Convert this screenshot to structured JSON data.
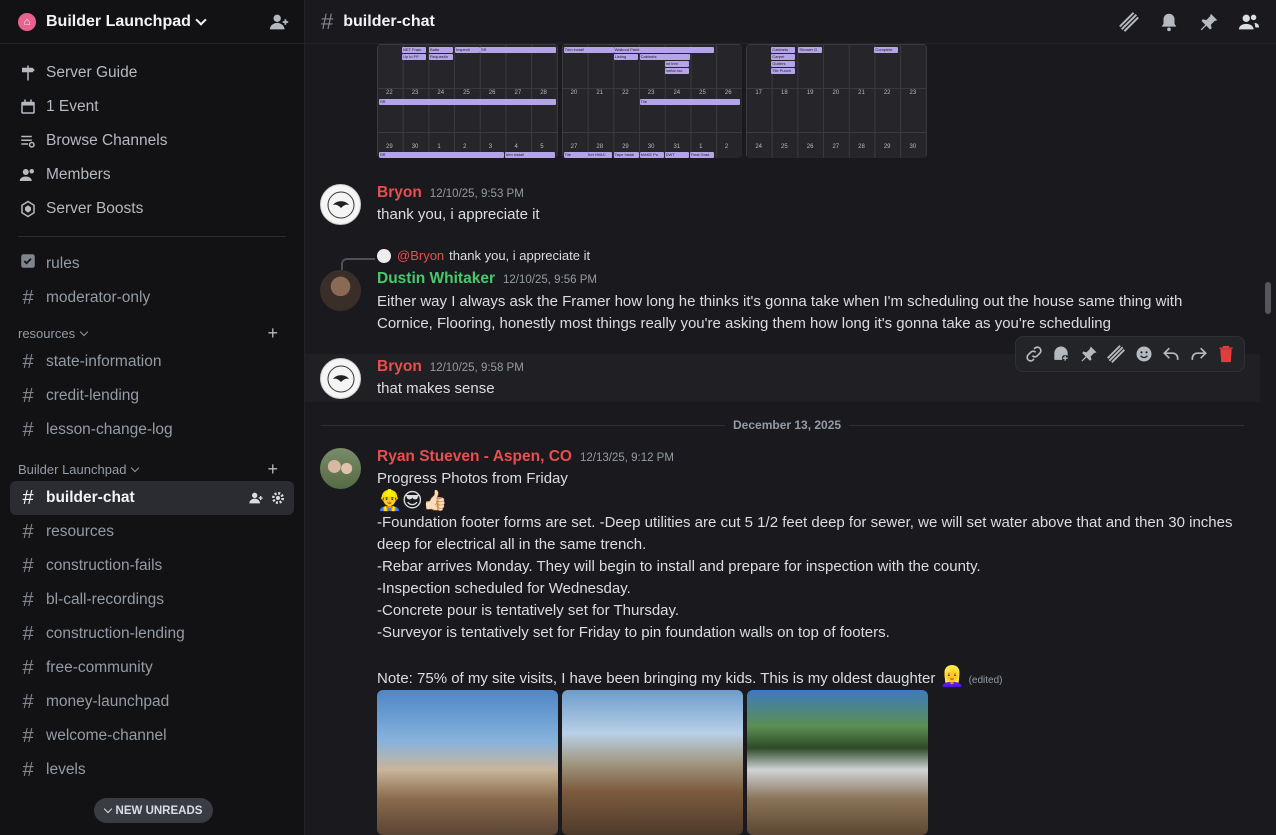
{
  "server": {
    "name": "Builder Launchpad"
  },
  "nav": [
    {
      "label": "Server Guide",
      "icon": "signpost-icon"
    },
    {
      "label": "1 Event",
      "icon": "calendar-icon"
    },
    {
      "label": "Browse Channels",
      "icon": "browse-icon"
    },
    {
      "label": "Members",
      "icon": "members-icon"
    },
    {
      "label": "Server Boosts",
      "icon": "boost-icon"
    }
  ],
  "top_channels": [
    {
      "label": "rules",
      "icon": "checklist-icon"
    },
    {
      "label": "moderator-only",
      "icon": "hash-lock-icon"
    }
  ],
  "categories": {
    "resources": {
      "label": "resources",
      "channels": [
        "state-information",
        "credit-lending",
        "lesson-change-log"
      ]
    },
    "launchpad": {
      "label": "Builder Launchpad",
      "channels": [
        "builder-chat",
        "resources",
        "construction-fails",
        "bl-call-recordings",
        "construction-lending",
        "free-community",
        "money-launchpad",
        "welcome-channel",
        "levels"
      ]
    }
  },
  "new_unreads": "NEW UNREADS",
  "channel": {
    "title": "builder-chat"
  },
  "messages": {
    "m1": {
      "author": "Bryon",
      "timestamp": "12/10/25, 9:53 PM",
      "text": "thank you, i appreciate it"
    },
    "m2": {
      "reply_mention": "@Bryon",
      "reply_text": "thank you, i appreciate it",
      "author": "Dustin Whitaker",
      "timestamp": "12/10/25, 9:56 PM",
      "text": "Either way I always ask the Framer how long he thinks it's gonna take when I'm scheduling out the house same thing with Cornice, Flooring, honestly most things really you're asking them how long it's gonna take as you're scheduling"
    },
    "m3": {
      "author": "Bryon",
      "timestamp": "12/10/25, 9:58 PM",
      "text": "that makes sense"
    },
    "date_divider": "December 13, 2025",
    "m4": {
      "author": "Ryan Stueven - Aspen, CO",
      "timestamp": "12/13/25, 9:12 PM",
      "line1": "Progress Photos from Friday",
      "emojis": "👷‍♂️😎👍🏻",
      "line2": "-Foundation footer forms are set. -Deep utilities are cut 5 1/2 feet deep for sewer, we will set water above that and then 30 inches deep for electrical all in the same trench.",
      "line3": "-Rebar arrives Monday. They will begin to install and prepare for inspection with the county.",
      "line4": "-Inspection scheduled for Wednesday.",
      "line5": "-Concrete pour is tentatively set for Thursday.",
      "line6": "-Surveyor is tentatively set for Friday to pin foundation walls on top of footers.",
      "note": "Note: 75% of my site visits, I have been bringing my kids. This is my oldest daughter",
      "note_emoji": "👱‍♀️",
      "edited": "(edited)"
    }
  },
  "calendar": {
    "labels": [
      "NET Fram",
      "Batte",
      "Inspecti",
      "SR",
      "Trim install",
      "Walkout Paint",
      "Cabinets",
      "Shower G",
      "Complete",
      "Up to FP",
      "Requestin",
      "Listing",
      "Cabinets",
      "Carpet",
      "Gutters",
      "Tile Punch",
      "Int trim",
      "metal roo",
      "SR",
      "Tile",
      "SR",
      "trim install",
      "Tile",
      "Set HVAC",
      "Tape Instal",
      "MAKE Pu",
      "DWT",
      "Final Grad"
    ],
    "days": [
      "22",
      "23",
      "24",
      "25",
      "26",
      "27",
      "28",
      "20",
      "21",
      "22",
      "23",
      "24",
      "25",
      "26",
      "17",
      "18",
      "19",
      "20",
      "21",
      "22",
      "23",
      "29",
      "30",
      "1",
      "2",
      "3",
      "4",
      "5",
      "27",
      "28",
      "29",
      "30",
      "31",
      "1",
      "2",
      "24",
      "25",
      "26",
      "27",
      "28",
      "29",
      "30"
    ]
  },
  "colors": {
    "accent_red": "#ea4e4e",
    "accent_green": "#48c96d",
    "bar_purple": "#b6a4e8"
  }
}
